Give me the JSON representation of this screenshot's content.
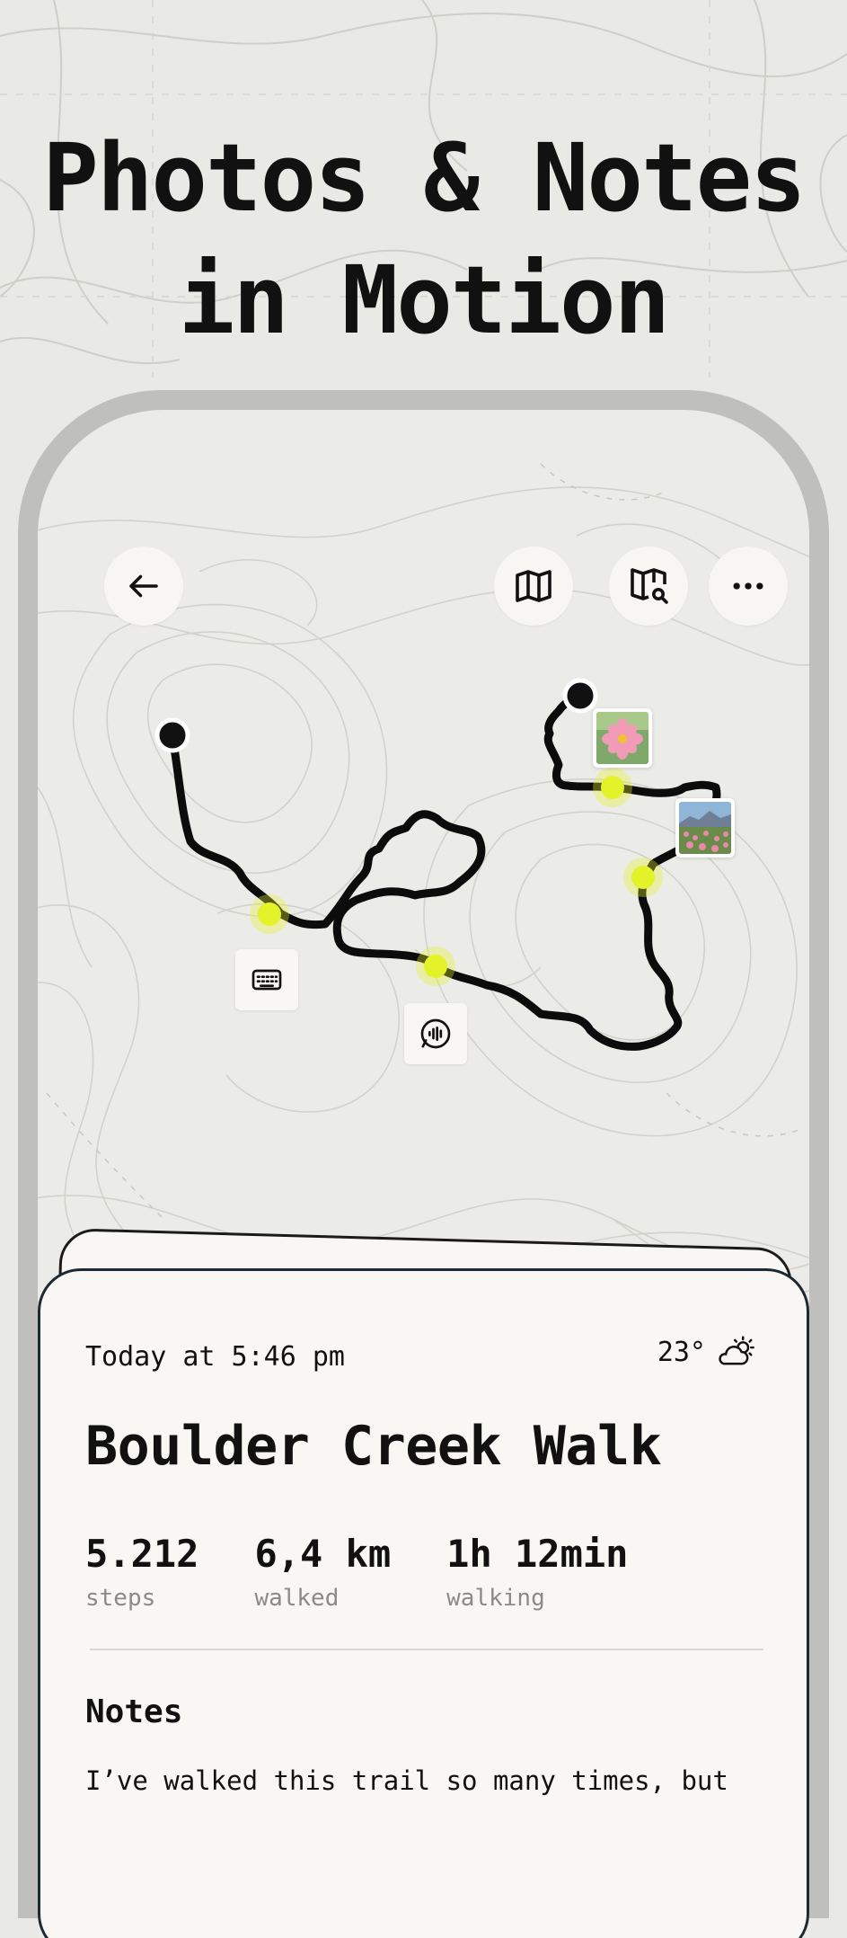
{
  "headline": {
    "line1": "Photos & Notes",
    "line2": "in Motion"
  },
  "toolbar": {
    "back_icon": "arrow-left-icon",
    "map_icon": "map-icon",
    "map_search_icon": "map-search-icon",
    "more_icon": "more-horizontal-icon"
  },
  "map_annotations": [
    {
      "type": "keyboard-note",
      "icon": "keyboard-icon"
    },
    {
      "type": "voice-note",
      "icon": "voice-message-icon"
    },
    {
      "type": "photo",
      "subject": "pink flower"
    },
    {
      "type": "photo",
      "subject": "flower field with mountains"
    }
  ],
  "walk": {
    "time": "Today at 5:46 pm",
    "temperature": "23°",
    "weather_icon": "partly-sunny-icon",
    "title": "Boulder Creek Walk",
    "stats": [
      {
        "value": "5.212",
        "label": "steps"
      },
      {
        "value": "6,4 km",
        "label": "walked"
      },
      {
        "value": "1h 12min",
        "label": "walking"
      }
    ],
    "notes_heading": "Notes",
    "notes_text": "I’ve walked this trail so many times, but"
  },
  "colors": {
    "accent": "#e4f22a",
    "route": "#0c0c0c",
    "background": "#e9e9e5",
    "card": "#f8f7f3"
  }
}
